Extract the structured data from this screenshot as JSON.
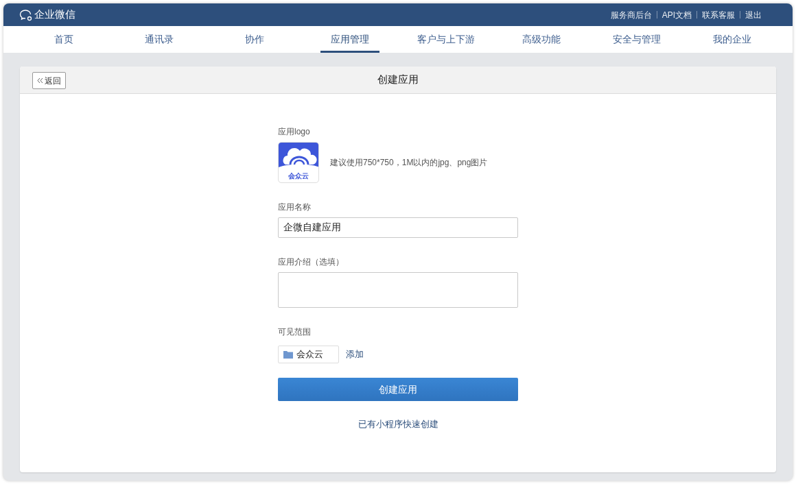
{
  "header": {
    "brand": "企业微信",
    "links": [
      "服务商后台",
      "API文档",
      "联系客服",
      "退出"
    ]
  },
  "tabs": [
    {
      "label": "首页",
      "selected": false
    },
    {
      "label": "通讯录",
      "selected": false
    },
    {
      "label": "协作",
      "selected": false
    },
    {
      "label": "应用管理",
      "selected": true
    },
    {
      "label": "客户与上下游",
      "selected": false
    },
    {
      "label": "高级功能",
      "selected": false
    },
    {
      "label": "安全与管理",
      "selected": false
    },
    {
      "label": "我的企业",
      "selected": false
    }
  ],
  "card": {
    "back_button": "返回",
    "title": "创建应用"
  },
  "form": {
    "logo_label": "应用logo",
    "logo_text": "会众云",
    "logo_hint": "建议使用750*750，1M以内的jpg、png图片",
    "name_label": "应用名称",
    "name_value": "企微自建应用",
    "intro_label": "应用介绍（选填）",
    "scope_label": "可见范围",
    "scope_items": [
      "会众云"
    ],
    "add_link": "添加",
    "submit": "创建应用",
    "mini_program_link": "已有小程序快速创建"
  }
}
